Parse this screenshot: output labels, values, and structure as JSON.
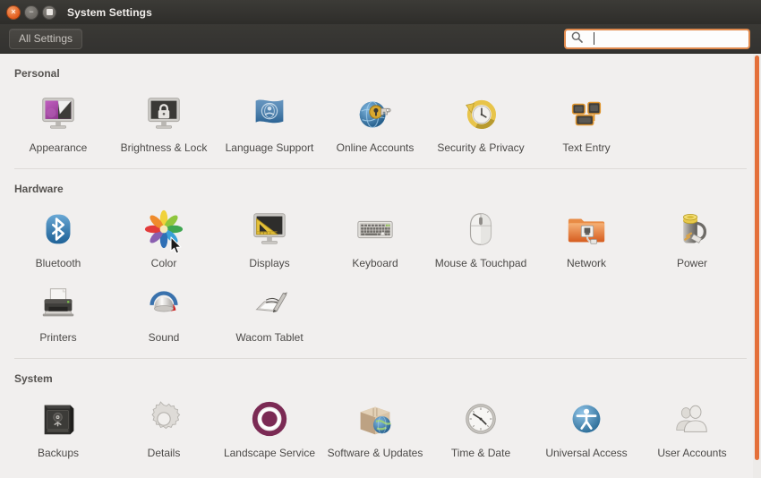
{
  "window": {
    "title": "System Settings",
    "controls": [
      {
        "name": "close",
        "glyph": "×"
      },
      {
        "name": "minimize",
        "glyph": "−"
      },
      {
        "name": "maximize",
        "glyph": ""
      }
    ]
  },
  "toolbar": {
    "all_settings_label": "All Settings",
    "search": {
      "value": "",
      "placeholder": "",
      "icon": "search-icon"
    }
  },
  "colors": {
    "accent_orange": "#e4703a",
    "titlebar_dark": "#3c3b37",
    "content_bg": "#f1efee",
    "label_text": "#4c4a48",
    "section_text": "#565350"
  },
  "sections": [
    {
      "id": "personal",
      "title": "Personal",
      "items": [
        {
          "label": "Appearance",
          "icon": "appearance-icon"
        },
        {
          "label": "Brightness & Lock",
          "icon": "brightness-lock-icon"
        },
        {
          "label": "Language Support",
          "icon": "language-support-icon"
        },
        {
          "label": "Online Accounts",
          "icon": "online-accounts-icon"
        },
        {
          "label": "Security & Privacy",
          "icon": "security-privacy-icon"
        },
        {
          "label": "Text Entry",
          "icon": "text-entry-icon"
        }
      ]
    },
    {
      "id": "hardware",
      "title": "Hardware",
      "items": [
        {
          "label": "Bluetooth",
          "icon": "bluetooth-icon"
        },
        {
          "label": "Color",
          "icon": "color-icon"
        },
        {
          "label": "Displays",
          "icon": "displays-icon"
        },
        {
          "label": "Keyboard",
          "icon": "keyboard-icon"
        },
        {
          "label": "Mouse & Touchpad",
          "icon": "mouse-touchpad-icon"
        },
        {
          "label": "Network",
          "icon": "network-icon"
        },
        {
          "label": "Power",
          "icon": "power-icon"
        },
        {
          "label": "Printers",
          "icon": "printers-icon"
        },
        {
          "label": "Sound",
          "icon": "sound-icon"
        },
        {
          "label": "Wacom Tablet",
          "icon": "wacom-tablet-icon"
        }
      ]
    },
    {
      "id": "system",
      "title": "System",
      "items": [
        {
          "label": "Backups",
          "icon": "backups-icon"
        },
        {
          "label": "Details",
          "icon": "details-icon"
        },
        {
          "label": "Landscape Service",
          "icon": "landscape-service-icon"
        },
        {
          "label": "Software & Updates",
          "icon": "software-updates-icon"
        },
        {
          "label": "Time & Date",
          "icon": "time-date-icon"
        },
        {
          "label": "Universal Access",
          "icon": "universal-access-icon"
        },
        {
          "label": "User Accounts",
          "icon": "user-accounts-icon"
        }
      ]
    }
  ]
}
